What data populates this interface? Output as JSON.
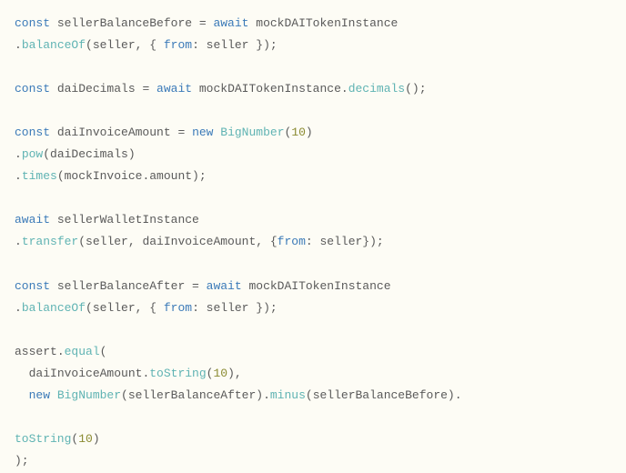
{
  "code": {
    "tokens": [
      {
        "t": "kw-const",
        "v": "const"
      },
      {
        "t": "plain",
        "v": " sellerBalanceBefore "
      },
      {
        "t": "punct",
        "v": "= "
      },
      {
        "t": "kw-await",
        "v": "await"
      },
      {
        "t": "plain",
        "v": " mockDAITokenInstance"
      },
      {
        "t": "break",
        "v": ""
      },
      {
        "t": "punct",
        "v": "."
      },
      {
        "t": "fn",
        "v": "balanceOf"
      },
      {
        "t": "punct",
        "v": "(seller, { "
      },
      {
        "t": "kw-from",
        "v": "from"
      },
      {
        "t": "punct",
        "v": ": seller });"
      },
      {
        "t": "break",
        "v": ""
      },
      {
        "t": "blank",
        "v": ""
      },
      {
        "t": "break",
        "v": ""
      },
      {
        "t": "kw-const",
        "v": "const"
      },
      {
        "t": "plain",
        "v": " daiDecimals "
      },
      {
        "t": "punct",
        "v": "= "
      },
      {
        "t": "kw-await",
        "v": "await"
      },
      {
        "t": "plain",
        "v": " mockDAITokenInstance"
      },
      {
        "t": "punct",
        "v": "."
      },
      {
        "t": "fn",
        "v": "decimals"
      },
      {
        "t": "punct",
        "v": "();"
      },
      {
        "t": "break",
        "v": ""
      },
      {
        "t": "blank",
        "v": ""
      },
      {
        "t": "break",
        "v": ""
      },
      {
        "t": "kw-const",
        "v": "const"
      },
      {
        "t": "plain",
        "v": " daiInvoiceAmount "
      },
      {
        "t": "punct",
        "v": "= "
      },
      {
        "t": "kw-new",
        "v": "new"
      },
      {
        "t": "plain",
        "v": " "
      },
      {
        "t": "fn",
        "v": "BigNumber"
      },
      {
        "t": "punct",
        "v": "("
      },
      {
        "t": "num",
        "v": "10"
      },
      {
        "t": "punct",
        "v": ")"
      },
      {
        "t": "break",
        "v": ""
      },
      {
        "t": "punct",
        "v": "."
      },
      {
        "t": "fn",
        "v": "pow"
      },
      {
        "t": "punct",
        "v": "(daiDecimals)"
      },
      {
        "t": "break",
        "v": ""
      },
      {
        "t": "punct",
        "v": "."
      },
      {
        "t": "fn",
        "v": "times"
      },
      {
        "t": "punct",
        "v": "(mockInvoice.amount);"
      },
      {
        "t": "break",
        "v": ""
      },
      {
        "t": "blank",
        "v": ""
      },
      {
        "t": "break",
        "v": ""
      },
      {
        "t": "kw-await",
        "v": "await"
      },
      {
        "t": "plain",
        "v": " sellerWalletInstance"
      },
      {
        "t": "break",
        "v": ""
      },
      {
        "t": "punct",
        "v": "."
      },
      {
        "t": "fn",
        "v": "transfer"
      },
      {
        "t": "punct",
        "v": "(seller, daiInvoiceAmount, {"
      },
      {
        "t": "kw-from",
        "v": "from"
      },
      {
        "t": "punct",
        "v": ": seller});"
      },
      {
        "t": "break",
        "v": ""
      },
      {
        "t": "blank",
        "v": ""
      },
      {
        "t": "break",
        "v": ""
      },
      {
        "t": "kw-const",
        "v": "const"
      },
      {
        "t": "plain",
        "v": " sellerBalanceAfter "
      },
      {
        "t": "punct",
        "v": "= "
      },
      {
        "t": "kw-await",
        "v": "await"
      },
      {
        "t": "plain",
        "v": " mockDAITokenInstance"
      },
      {
        "t": "break",
        "v": ""
      },
      {
        "t": "punct",
        "v": "."
      },
      {
        "t": "fn",
        "v": "balanceOf"
      },
      {
        "t": "punct",
        "v": "(seller, { "
      },
      {
        "t": "kw-from",
        "v": "from"
      },
      {
        "t": "punct",
        "v": ": seller });"
      },
      {
        "t": "break",
        "v": ""
      },
      {
        "t": "blank",
        "v": ""
      },
      {
        "t": "break",
        "v": ""
      },
      {
        "t": "plain",
        "v": "assert"
      },
      {
        "t": "punct",
        "v": "."
      },
      {
        "t": "fn",
        "v": "equal"
      },
      {
        "t": "punct",
        "v": "("
      },
      {
        "t": "break",
        "v": ""
      },
      {
        "t": "indent",
        "v": "  "
      },
      {
        "t": "plain",
        "v": "daiInvoiceAmount"
      },
      {
        "t": "punct",
        "v": "."
      },
      {
        "t": "fn",
        "v": "toString"
      },
      {
        "t": "punct",
        "v": "("
      },
      {
        "t": "num",
        "v": "10"
      },
      {
        "t": "punct",
        "v": "),"
      },
      {
        "t": "break",
        "v": ""
      },
      {
        "t": "indent",
        "v": "  "
      },
      {
        "t": "kw-new",
        "v": "new"
      },
      {
        "t": "plain",
        "v": " "
      },
      {
        "t": "fn",
        "v": "BigNumber"
      },
      {
        "t": "punct",
        "v": "(sellerBalanceAfter)."
      },
      {
        "t": "fn",
        "v": "minus"
      },
      {
        "t": "punct",
        "v": "(sellerBalanceBefore)."
      },
      {
        "t": "break",
        "v": ""
      },
      {
        "t": "blank",
        "v": ""
      },
      {
        "t": "break",
        "v": ""
      },
      {
        "t": "fn",
        "v": "toString"
      },
      {
        "t": "punct",
        "v": "("
      },
      {
        "t": "num",
        "v": "10"
      },
      {
        "t": "punct",
        "v": ")"
      },
      {
        "t": "break",
        "v": ""
      },
      {
        "t": "punct",
        "v": ");"
      }
    ]
  }
}
